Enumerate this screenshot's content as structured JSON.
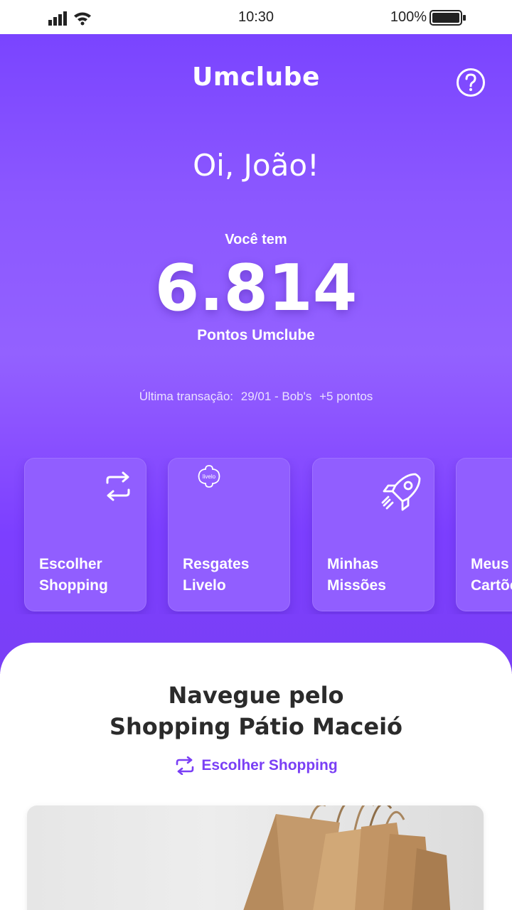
{
  "status_bar": {
    "time": "10:30",
    "battery": "100%",
    "icons": [
      "signal-icon",
      "wifi-icon",
      "battery-icon"
    ]
  },
  "header": {
    "brand": "Umclube",
    "help_icon": "question-circle-icon"
  },
  "greeting": "Oi, João!",
  "points": {
    "prefix": "Você tem",
    "value": "6.814",
    "label": "Pontos Umclube"
  },
  "last_transaction": {
    "label": "Última transação:",
    "date_place": "29/01 - Bob's",
    "points": "+5 pontos"
  },
  "cards": [
    {
      "line1": "Escolher",
      "line2": "Shopping",
      "icon": "swap-arrows-icon"
    },
    {
      "line1": "Resgates",
      "line2": "Livelo",
      "icon": "livelo-logo-icon"
    },
    {
      "line1": "Minhas",
      "line2": "Missões",
      "icon": "rocket-icon"
    },
    {
      "line1": "Meus",
      "line2": "Cartões",
      "icon": "card-icon"
    }
  ],
  "section": {
    "title_line1": "Navegue pelo",
    "title_line2": "Shopping Pátio Maceió",
    "link": "Escolher Shopping",
    "link_icon": "swap-arrows-icon"
  },
  "banner": {
    "image": "shopping-bags-image"
  },
  "colors": {
    "primary": "#7a3ff5",
    "card": "#915eff",
    "text_dark": "#2b2b2b"
  }
}
